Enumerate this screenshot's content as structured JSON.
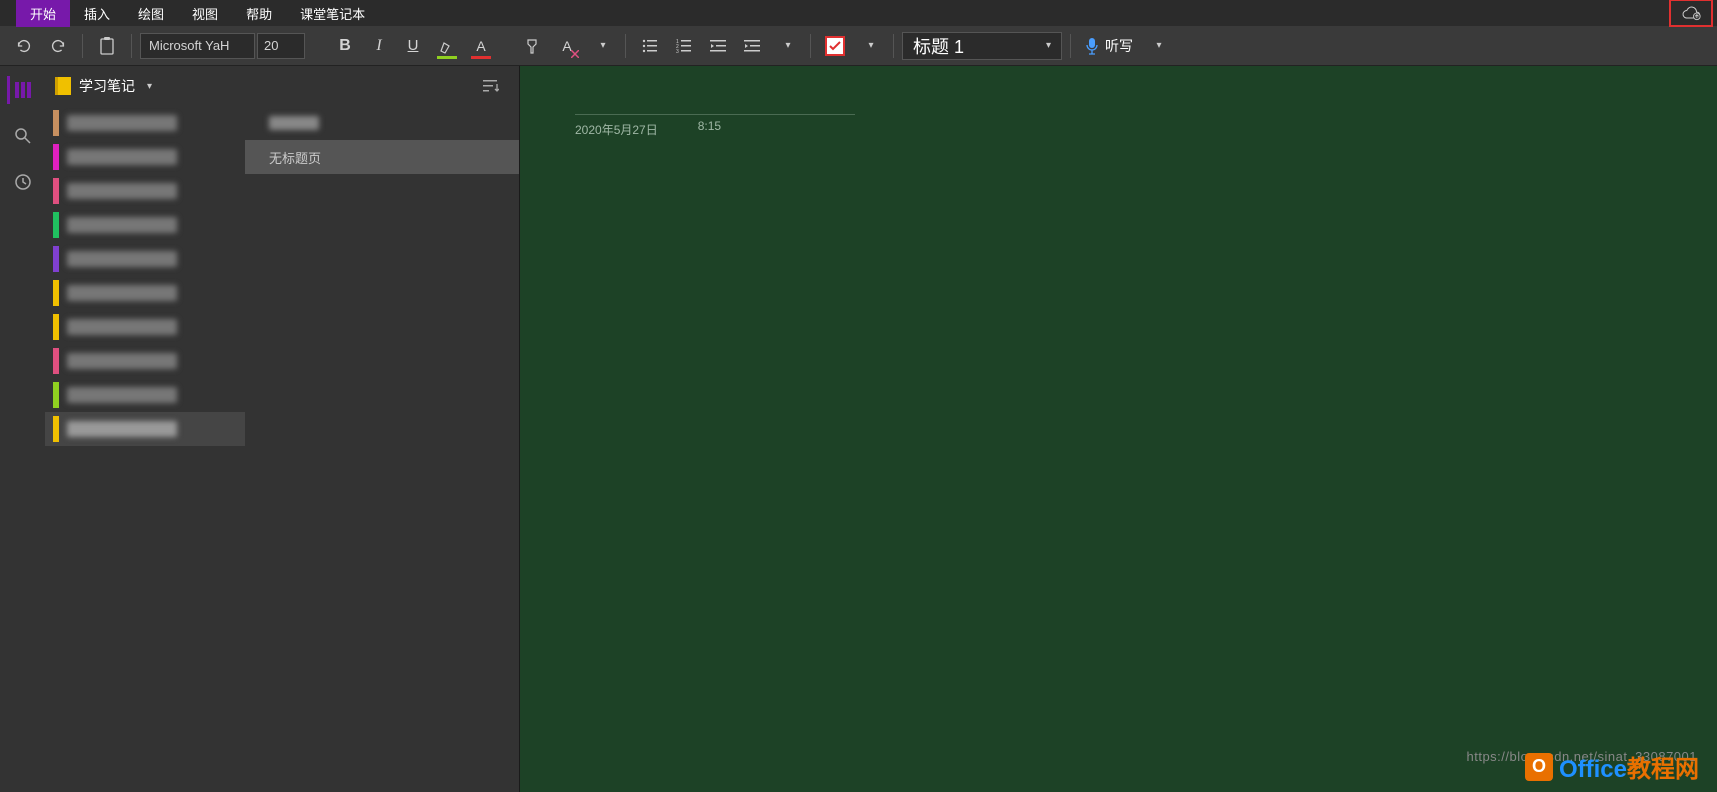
{
  "menu": {
    "items": [
      "开始",
      "插入",
      "绘图",
      "视图",
      "帮助",
      "课堂笔记本"
    ],
    "activeIndex": 0
  },
  "toolbar": {
    "font_name": "Microsoft YaH",
    "font_size": "20",
    "style_label": "标题 1",
    "dictate_label": "听写"
  },
  "notebook": {
    "name": "学习笔记"
  },
  "sections": [
    {
      "color": "#c79060"
    },
    {
      "color": "#e020c0"
    },
    {
      "color": "#e05080"
    },
    {
      "color": "#20c060"
    },
    {
      "color": "#8040d0"
    },
    {
      "color": "#f0c000"
    },
    {
      "color": "#f0c000"
    },
    {
      "color": "#e05080"
    },
    {
      "color": "#90d020"
    },
    {
      "color": "#f0c000",
      "selected": true
    }
  ],
  "pages": [
    {
      "blurred": true
    },
    {
      "label": "无标题页",
      "selected": true
    }
  ],
  "content": {
    "date": "2020年5月27日",
    "time": "8:15"
  },
  "watermark": {
    "url": "https://blog.csdn.net/sinat_33087001",
    "logo_text_a": "Office",
    "logo_text_b": "教程网"
  }
}
